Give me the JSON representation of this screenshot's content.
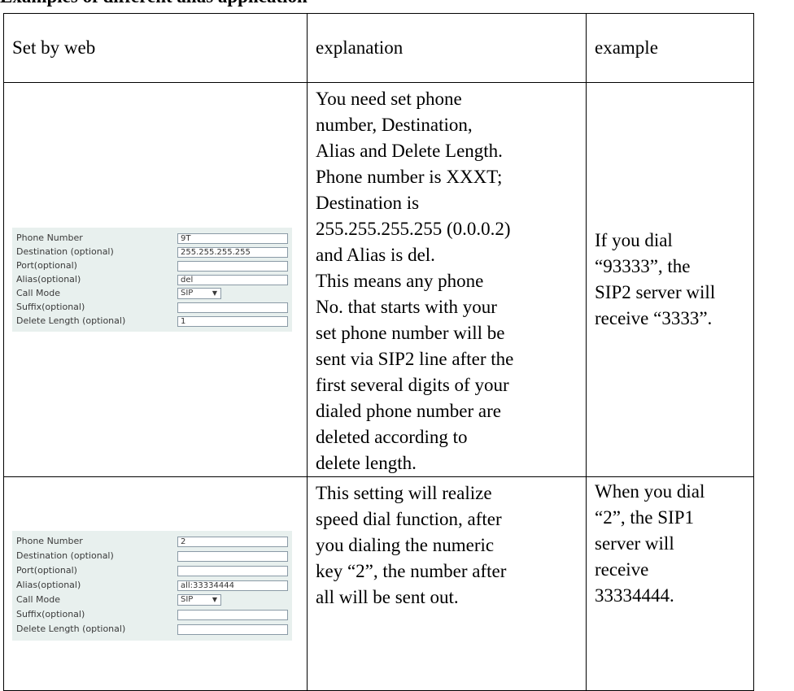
{
  "heading": "Examples of different alias application",
  "table": {
    "headers": [
      "Set by web",
      "explanation",
      "example"
    ],
    "rows": [
      {
        "form": [
          {
            "label": "Phone Number",
            "value": "9T",
            "type": "input"
          },
          {
            "label": "Destination (optional)",
            "value": "255.255.255.255",
            "type": "input"
          },
          {
            "label": "Port(optional)",
            "value": "",
            "type": "input"
          },
          {
            "label": "Alias(optional)",
            "value": "del",
            "type": "input"
          },
          {
            "label": "Call Mode",
            "value": "SIP",
            "type": "select"
          },
          {
            "label": "Suffix(optional)",
            "value": "",
            "type": "input"
          },
          {
            "label": "Delete Length (optional)",
            "value": "1",
            "type": "input"
          }
        ],
        "explanation_lines": [
          "You need set phone",
          "number, Destination,",
          "Alias and Delete Length.",
          "Phone number is XXXT;",
          "Destination is",
          "255.255.255.255 (0.0.0.2)",
          "and Alias is del.",
          "This means any phone",
          "No. that starts with your",
          "set phone number will be",
          "sent via SIP2 line after the",
          "first several digits of your",
          "dialed phone number are",
          "deleted according to",
          "delete length."
        ],
        "example_lines": [
          "If you dial",
          "“93333”, the",
          "SIP2 server will",
          "receive “3333”."
        ]
      },
      {
        "form": [
          {
            "label": "Phone Number",
            "value": "2",
            "type": "input"
          },
          {
            "label": "Destination (optional)",
            "value": "",
            "type": "input"
          },
          {
            "label": "Port(optional)",
            "value": "",
            "type": "input"
          },
          {
            "label": "Alias(optional)",
            "value": "all:33334444",
            "type": "input"
          },
          {
            "label": "Call Mode",
            "value": "SIP",
            "type": "select"
          },
          {
            "label": "Suffix(optional)",
            "value": "",
            "type": "input"
          },
          {
            "label": "Delete Length (optional)",
            "value": "",
            "type": "input"
          }
        ],
        "explanation_lines": [
          "This setting will realize",
          "speed dial function, after",
          "you dialing the numeric",
          "key “2”, the number after",
          "all will be sent out."
        ],
        "example_lines": [
          "When you dial",
          "“2”, the SIP1",
          "server will",
          "receive",
          "33334444."
        ]
      }
    ]
  }
}
